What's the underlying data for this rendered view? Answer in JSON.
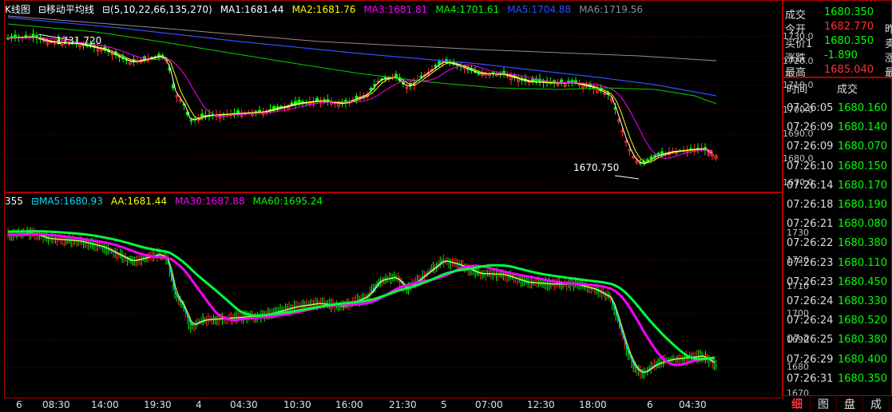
{
  "upper": {
    "legend": [
      {
        "text": "K线图",
        "color": "#ffffff"
      },
      {
        "text": "⊟移动平均线",
        "color": "#ffffff"
      },
      {
        "text": "⊟(5,10,22,66,135,270)",
        "color": "#ffffff"
      },
      {
        "text": "MA1:1681.44",
        "color": "#ffffff"
      },
      {
        "text": "MA2:1681.76",
        "color": "#ffff00"
      },
      {
        "text": "MA3:1681.81",
        "color": "#ff00ff"
      },
      {
        "text": "MA4:1701.61",
        "color": "#00ff00"
      },
      {
        "text": "MA5:1704.88",
        "color": "#3050ff"
      },
      {
        "text": "MA6:1719.56",
        "color": "#909090"
      }
    ],
    "y_ticks": [
      "1730.0",
      "1720.0",
      "1710.0",
      "1700.0",
      "1690.0",
      "1680.0",
      "1670.0"
    ],
    "high_annotation": "1731.720",
    "low_annotation": "1670.750"
  },
  "lower": {
    "legend": [
      {
        "text": "355",
        "color": "#ffffff"
      },
      {
        "text": "⊟MA5:1680.93",
        "color": "#00e0ff"
      },
      {
        "text": "AA:1681.44",
        "color": "#ffff00"
      },
      {
        "text": "MA30:1687.88",
        "color": "#ff00ff"
      },
      {
        "text": "MA60:1695.24",
        "color": "#00ff00"
      }
    ],
    "y_ticks": [
      "1730",
      "1720",
      "1710",
      "1700",
      "1690",
      "1680",
      "1670"
    ]
  },
  "x_labels": [
    "6",
    "08:30",
    "14:00",
    "19:30",
    "4",
    "04:30",
    "10:30",
    "16:00",
    "21:30",
    "5",
    "07:00",
    "12:30",
    "18:00",
    "6",
    "04:30"
  ],
  "quote": {
    "rows": [
      {
        "label": "成交",
        "value": "1680.350",
        "color": "#00ff00",
        "extra": ""
      },
      {
        "label": "今开",
        "value": "1682.770",
        "color": "#ff3030",
        "extra": "昨"
      },
      {
        "label": "买价1",
        "value": "1680.350",
        "color": "#00ff00",
        "extra": "卖"
      },
      {
        "label": "涨跌",
        "value": "-1.890",
        "color": "#00ff00",
        "extra": "涨"
      },
      {
        "label": "最高",
        "value": "1685.040",
        "color": "#ff3030",
        "extra": "最"
      }
    ],
    "header_time": "时间",
    "header_price": "成交"
  },
  "trades": [
    {
      "time": "07:26:05",
      "price": "1680.160"
    },
    {
      "time": "07:26:09",
      "price": "1680.140"
    },
    {
      "time": "07:26:09",
      "price": "1680.070"
    },
    {
      "time": "07:26:10",
      "price": "1680.150"
    },
    {
      "time": "07:26:14",
      "price": "1680.170"
    },
    {
      "time": "07:26:18",
      "price": "1680.190"
    },
    {
      "time": "07:26:21",
      "price": "1680.080"
    },
    {
      "time": "07:26:22",
      "price": "1680.380"
    },
    {
      "time": "07:26:23",
      "price": "1680.110"
    },
    {
      "time": "07:26:23",
      "price": "1680.450"
    },
    {
      "time": "07:26:24",
      "price": "1680.330"
    },
    {
      "time": "07:26:24",
      "price": "1680.520"
    },
    {
      "time": "07:26:25",
      "price": "1680.380"
    },
    {
      "time": "07:26:29",
      "price": "1680.400"
    },
    {
      "time": "07:26:31",
      "price": "1680.350"
    }
  ],
  "tabs": [
    "细",
    "图",
    "盘",
    "成"
  ],
  "colors": {
    "up": "#ff3030",
    "down": "#00ff00",
    "grid": "#7a0000",
    "axis": "#b00000"
  }
}
